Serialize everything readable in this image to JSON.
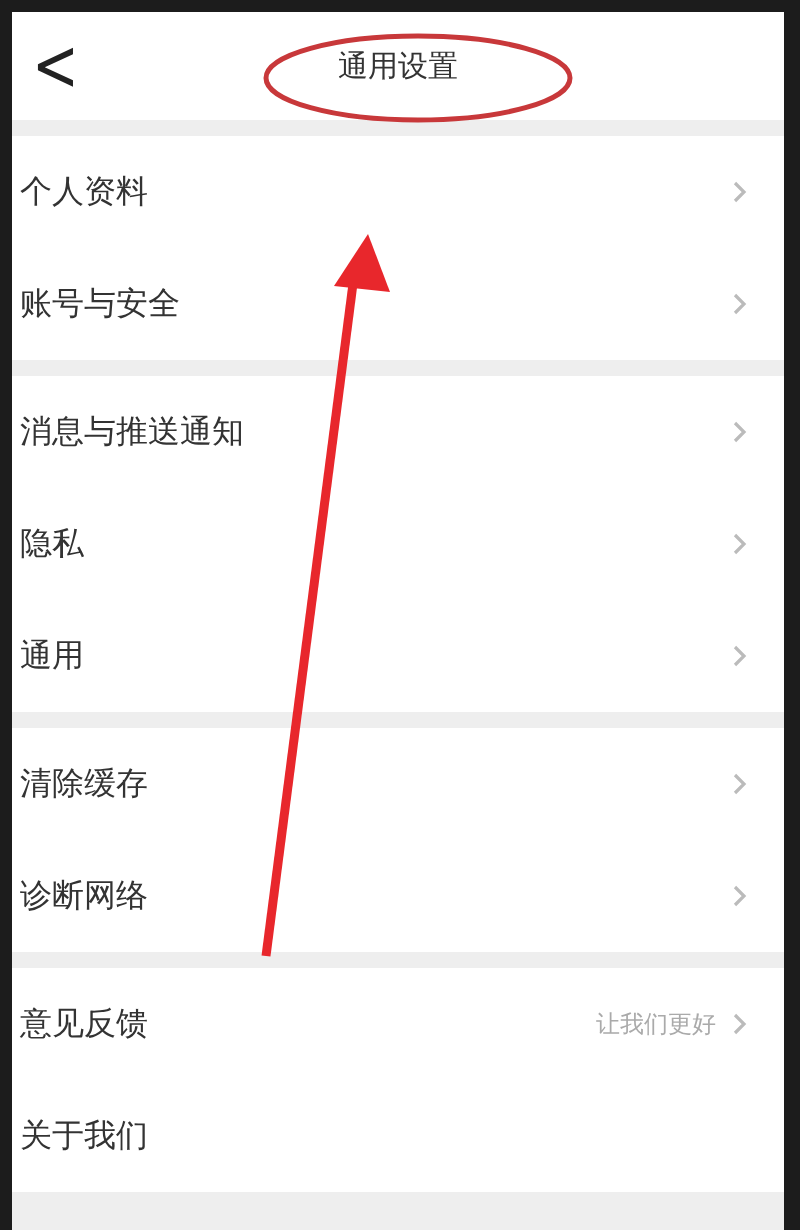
{
  "header": {
    "back": "<",
    "title": "通用设置"
  },
  "groups": [
    {
      "rows": [
        {
          "label": "个人资料",
          "chevron": true
        },
        {
          "label": "账号与安全",
          "chevron": true
        }
      ]
    },
    {
      "rows": [
        {
          "label": "消息与推送通知",
          "chevron": true
        },
        {
          "label": "隐私",
          "chevron": true
        },
        {
          "label": "通用",
          "chevron": true
        }
      ]
    },
    {
      "rows": [
        {
          "label": "清除缓存",
          "chevron": true
        },
        {
          "label": "诊断网络",
          "chevron": true
        }
      ]
    },
    {
      "rows": [
        {
          "label": "意见反馈",
          "hint": "让我们更好",
          "chevron": true
        },
        {
          "label": "关于我们",
          "chevron": false
        }
      ]
    }
  ]
}
